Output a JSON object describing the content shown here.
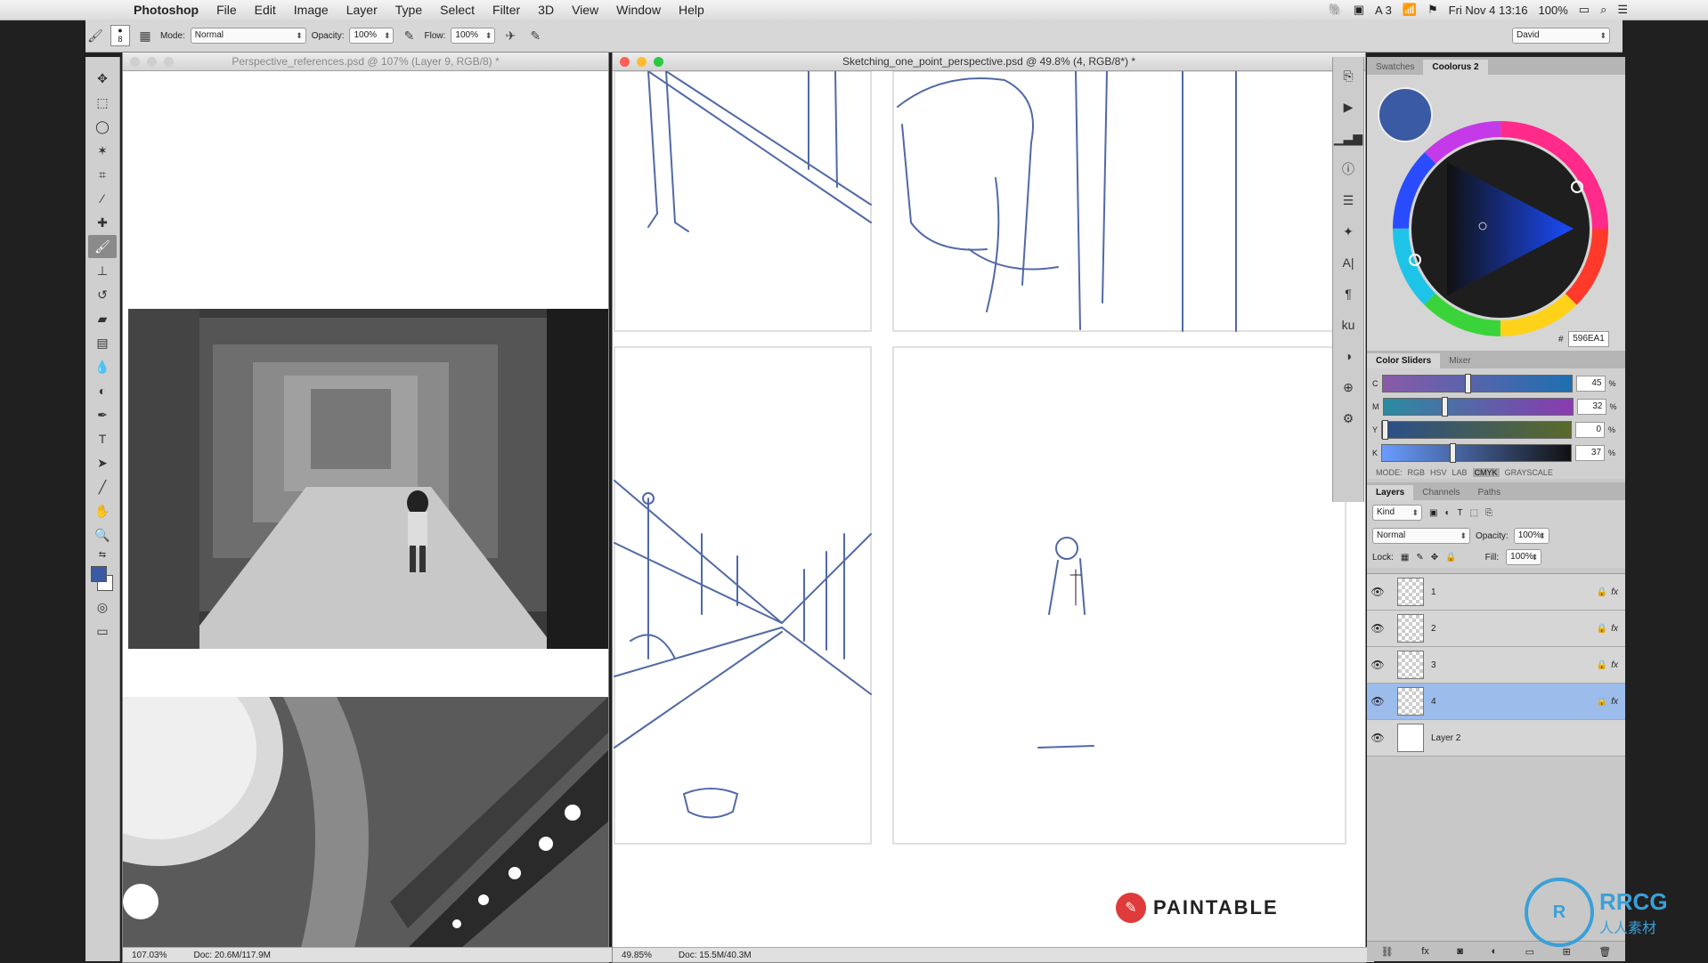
{
  "menubar": {
    "app": "Photoshop",
    "items": [
      "File",
      "Edit",
      "Image",
      "Layer",
      "Type",
      "Select",
      "Filter",
      "3D",
      "View",
      "Window",
      "Help"
    ],
    "status": {
      "adobe_count": "3",
      "datetime": "Fri Nov 4  13:16",
      "battery": "100%"
    }
  },
  "options": {
    "brush_size": "8",
    "mode_label": "Mode:",
    "mode_value": "Normal",
    "opacity_label": "Opacity:",
    "opacity_value": "100%",
    "flow_label": "Flow:",
    "flow_value": "100%",
    "workspace": "David"
  },
  "doc1": {
    "title": "Perspective_references.psd @ 107% (Layer 9, RGB/8) *",
    "zoom": "107.03%",
    "doc_size": "Doc: 20.6M/117.9M"
  },
  "doc2": {
    "title": "Sketching_one_point_perspective.psd @ 49.8% (4, RGB/8*) *",
    "zoom": "49.85%",
    "doc_size": "Doc: 15.5M/40.3M",
    "logo": "PAINTABLE"
  },
  "swatch_panel": {
    "tabs": [
      "Swatches",
      "Coolorus 2"
    ],
    "hex_label": "#",
    "hex": "596EA1",
    "foreground_color": "#3a5aa3"
  },
  "color_sliders": {
    "tabs": [
      "Color Sliders",
      "Mixer"
    ],
    "rows": [
      {
        "label": "C",
        "value": "45",
        "unit": "%",
        "frac": 0.45
      },
      {
        "label": "M",
        "value": "32",
        "unit": "%",
        "frac": 0.32
      },
      {
        "label": "Y",
        "value": "0",
        "unit": "%",
        "frac": 0.0
      },
      {
        "label": "K",
        "value": "37",
        "unit": "%",
        "frac": 0.37
      }
    ],
    "mode_label": "MODE:",
    "modes": [
      "RGB",
      "HSV",
      "LAB",
      "CMYK",
      "GRAYSCALE"
    ],
    "active_mode": "CMYK"
  },
  "layers_panel": {
    "tabs": [
      "Layers",
      "Channels",
      "Paths"
    ],
    "filter": "Kind",
    "blend_mode": "Normal",
    "opacity_label": "Opacity:",
    "opacity_value": "100%",
    "lock_label": "Lock:",
    "fill_label": "Fill:",
    "fill_value": "100%",
    "layers": [
      {
        "name": "1",
        "selected": false
      },
      {
        "name": "2",
        "selected": false
      },
      {
        "name": "3",
        "selected": false
      },
      {
        "name": "4",
        "selected": true
      },
      {
        "name": "Layer 2",
        "selected": false
      }
    ]
  },
  "watermark": {
    "brand": "RRCG",
    "sub": "人人素材"
  }
}
